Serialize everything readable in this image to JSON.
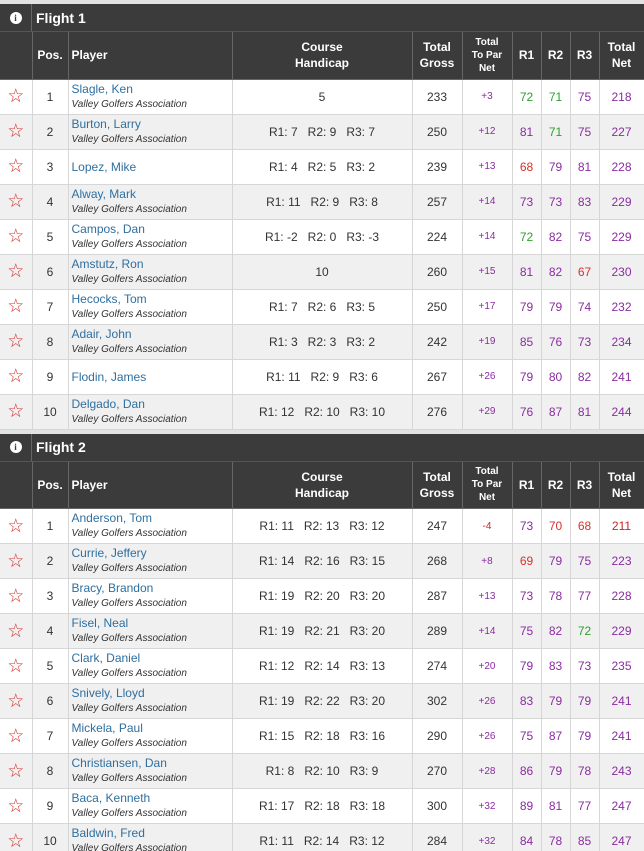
{
  "columns": {
    "pos": "Pos.",
    "player": "Player",
    "hcp1": "Course",
    "hcp2": "Handicap",
    "gross1": "Total",
    "gross2": "Gross",
    "topar1": "Total",
    "topar2": "To Par",
    "topar3": "Net",
    "r1": "R1",
    "r2": "R2",
    "r3": "R3",
    "net1": "Total",
    "net2": "Net"
  },
  "colors": {
    "green": "#2e9e2e",
    "red": "#d8312c",
    "purple": "#8a2ca0",
    "link": "#2f6f9f",
    "header": "#3b3b3b"
  },
  "flights": [
    {
      "title": "Flight 1",
      "rows": [
        {
          "pos": "1",
          "name": "Slagle, Ken",
          "assoc": "Valley Golfers Association",
          "hcp": "5",
          "gross": "233",
          "topar": "+3",
          "r1": "72",
          "r1c": "green",
          "r2": "71",
          "r2c": "green",
          "r3": "75",
          "r3c": "purple",
          "net": "218"
        },
        {
          "pos": "2",
          "name": "Burton, Larry",
          "assoc": "Valley Golfers Association",
          "hcp": [
            "R1: 7",
            "R2: 9",
            "R3: 7"
          ],
          "gross": "250",
          "topar": "+12",
          "r1": "81",
          "r1c": "purple",
          "r2": "71",
          "r2c": "green",
          "r3": "75",
          "r3c": "purple",
          "net": "227"
        },
        {
          "pos": "3",
          "name": "Lopez, Mike",
          "assoc": "",
          "hcp": [
            "R1: 4",
            "R2: 5",
            "R3: 2"
          ],
          "gross": "239",
          "topar": "+13",
          "r1": "68",
          "r1c": "red",
          "r2": "79",
          "r2c": "purple",
          "r3": "81",
          "r3c": "purple",
          "net": "228"
        },
        {
          "pos": "4",
          "name": "Alway, Mark",
          "assoc": "Valley Golfers Association",
          "hcp": [
            "R1: 11",
            "R2: 9",
            "R3: 8"
          ],
          "gross": "257",
          "topar": "+14",
          "r1": "73",
          "r1c": "purple",
          "r2": "73",
          "r2c": "purple",
          "r3": "83",
          "r3c": "purple",
          "net": "229"
        },
        {
          "pos": "5",
          "name": "Campos, Dan",
          "assoc": "Valley Golfers Association",
          "hcp": [
            "R1: -2",
            "R2: 0",
            "R3: -3"
          ],
          "gross": "224",
          "topar": "+14",
          "r1": "72",
          "r1c": "green",
          "r2": "82",
          "r2c": "purple",
          "r3": "75",
          "r3c": "purple",
          "net": "229"
        },
        {
          "pos": "6",
          "name": "Amstutz, Ron",
          "assoc": "Valley Golfers Association",
          "hcp": "10",
          "gross": "260",
          "topar": "+15",
          "r1": "81",
          "r1c": "purple",
          "r2": "82",
          "r2c": "purple",
          "r3": "67",
          "r3c": "red",
          "net": "230"
        },
        {
          "pos": "7",
          "name": "Hecocks, Tom",
          "assoc": "Valley Golfers Association",
          "hcp": [
            "R1: 7",
            "R2: 6",
            "R3: 5"
          ],
          "gross": "250",
          "topar": "+17",
          "r1": "79",
          "r1c": "purple",
          "r2": "79",
          "r2c": "purple",
          "r3": "74",
          "r3c": "purple",
          "net": "232"
        },
        {
          "pos": "8",
          "name": "Adair, John",
          "assoc": "Valley Golfers Association",
          "hcp": [
            "R1: 3",
            "R2: 3",
            "R3: 2"
          ],
          "gross": "242",
          "topar": "+19",
          "r1": "85",
          "r1c": "purple",
          "r2": "76",
          "r2c": "purple",
          "r3": "73",
          "r3c": "purple",
          "net": "234"
        },
        {
          "pos": "9",
          "name": "Flodin, James",
          "assoc": "",
          "hcp": [
            "R1: 11",
            "R2: 9",
            "R3: 6"
          ],
          "gross": "267",
          "topar": "+26",
          "r1": "79",
          "r1c": "purple",
          "r2": "80",
          "r2c": "purple",
          "r3": "82",
          "r3c": "purple",
          "net": "241"
        },
        {
          "pos": "10",
          "name": "Delgado, Dan",
          "assoc": "Valley Golfers Association",
          "hcp": [
            "R1: 12",
            "R2: 10",
            "R3: 10"
          ],
          "gross": "276",
          "topar": "+29",
          "r1": "76",
          "r1c": "purple",
          "r2": "87",
          "r2c": "purple",
          "r3": "81",
          "r3c": "purple",
          "net": "244"
        }
      ]
    },
    {
      "title": "Flight 2",
      "rows": [
        {
          "pos": "1",
          "name": "Anderson, Tom",
          "assoc": "Valley Golfers Association",
          "hcp": [
            "R1: 11",
            "R2: 13",
            "R3: 12"
          ],
          "gross": "247",
          "topar": "-4",
          "under": true,
          "r1": "73",
          "r1c": "purple",
          "r2": "70",
          "r2c": "red",
          "r3": "68",
          "r3c": "red",
          "net": "211"
        },
        {
          "pos": "2",
          "name": "Currie, Jeffery",
          "assoc": "Valley Golfers Association",
          "hcp": [
            "R1: 14",
            "R2: 16",
            "R3: 15"
          ],
          "gross": "268",
          "topar": "+8",
          "r1": "69",
          "r1c": "red",
          "r2": "79",
          "r2c": "purple",
          "r3": "75",
          "r3c": "purple",
          "net": "223"
        },
        {
          "pos": "3",
          "name": "Bracy, Brandon",
          "assoc": "Valley Golfers Association",
          "hcp": [
            "R1: 19",
            "R2: 20",
            "R3: 20"
          ],
          "gross": "287",
          "topar": "+13",
          "r1": "73",
          "r1c": "purple",
          "r2": "78",
          "r2c": "purple",
          "r3": "77",
          "r3c": "purple",
          "net": "228"
        },
        {
          "pos": "4",
          "name": "Fisel, Neal",
          "assoc": "Valley Golfers Association",
          "hcp": [
            "R1: 19",
            "R2: 21",
            "R3: 20"
          ],
          "gross": "289",
          "topar": "+14",
          "r1": "75",
          "r1c": "purple",
          "r2": "82",
          "r2c": "purple",
          "r3": "72",
          "r3c": "green",
          "net": "229"
        },
        {
          "pos": "5",
          "name": "Clark, Daniel",
          "assoc": "Valley Golfers Association",
          "hcp": [
            "R1: 12",
            "R2: 14",
            "R3: 13"
          ],
          "gross": "274",
          "topar": "+20",
          "r1": "79",
          "r1c": "purple",
          "r2": "83",
          "r2c": "purple",
          "r3": "73",
          "r3c": "purple",
          "net": "235"
        },
        {
          "pos": "6",
          "name": "Snively, Lloyd",
          "assoc": "Valley Golfers Association",
          "hcp": [
            "R1: 19",
            "R2: 22",
            "R3: 20"
          ],
          "gross": "302",
          "topar": "+26",
          "r1": "83",
          "r1c": "purple",
          "r2": "79",
          "r2c": "purple",
          "r3": "79",
          "r3c": "purple",
          "net": "241"
        },
        {
          "pos": "7",
          "name": "Mickela, Paul",
          "assoc": "Valley Golfers Association",
          "hcp": [
            "R1: 15",
            "R2: 18",
            "R3: 16"
          ],
          "gross": "290",
          "topar": "+26",
          "r1": "75",
          "r1c": "purple",
          "r2": "87",
          "r2c": "purple",
          "r3": "79",
          "r3c": "purple",
          "net": "241"
        },
        {
          "pos": "8",
          "name": "Christiansen, Dan",
          "assoc": "Valley Golfers Association",
          "hcp": [
            "R1: 8",
            "R2: 10",
            "R3: 9"
          ],
          "gross": "270",
          "topar": "+28",
          "r1": "86",
          "r1c": "purple",
          "r2": "79",
          "r2c": "purple",
          "r3": "78",
          "r3c": "purple",
          "net": "243"
        },
        {
          "pos": "9",
          "name": "Baca, Kenneth",
          "assoc": "Valley Golfers Association",
          "hcp": [
            "R1: 17",
            "R2: 18",
            "R3: 18"
          ],
          "gross": "300",
          "topar": "+32",
          "r1": "89",
          "r1c": "purple",
          "r2": "81",
          "r2c": "purple",
          "r3": "77",
          "r3c": "purple",
          "net": "247"
        },
        {
          "pos": "10",
          "name": "Baldwin, Fred",
          "assoc": "Valley Golfers Association",
          "hcp": [
            "R1: 11",
            "R2: 14",
            "R3: 12"
          ],
          "gross": "284",
          "topar": "+32",
          "r1": "84",
          "r1c": "purple",
          "r2": "78",
          "r2c": "purple",
          "r3": "85",
          "r3c": "purple",
          "net": "247"
        }
      ]
    }
  ]
}
